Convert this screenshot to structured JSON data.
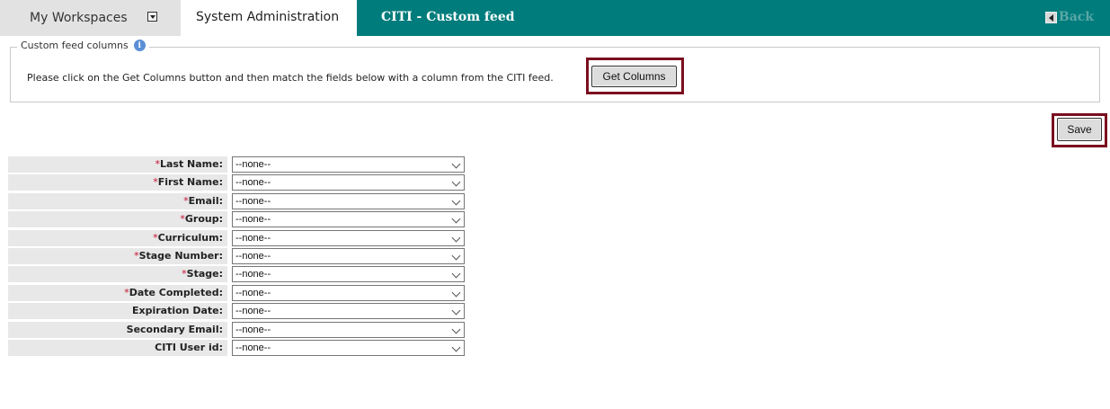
{
  "tabs": {
    "workspaces": "My Workspaces",
    "system_admin": "System Administration",
    "current": "CITI - Custom feed",
    "back": "Back"
  },
  "fieldset": {
    "legend": "Custom feed columns",
    "instruction": "Please click on the Get Columns button and then match the fields below with a column from the CITI feed.",
    "get_columns_label": "Get Columns"
  },
  "save_label": "Save",
  "fields": [
    {
      "label": "Last Name:",
      "required": "*",
      "value": "--none--"
    },
    {
      "label": "First Name:",
      "required": "*",
      "value": "--none--"
    },
    {
      "label": "Email:",
      "required": "*",
      "value": "--none--"
    },
    {
      "label": "Group:",
      "required": "*",
      "value": "--none--"
    },
    {
      "label": "Curriculum:",
      "required": "*",
      "value": "--none--"
    },
    {
      "label": "Stage Number:",
      "required": "*",
      "value": "--none--"
    },
    {
      "label": "Stage:",
      "required": "*",
      "value": "--none--"
    },
    {
      "label": "Date Completed:",
      "required": "*",
      "value": "--none--"
    },
    {
      "label": "Expiration Date:",
      "required": "",
      "value": "--none--"
    },
    {
      "label": "Secondary Email:",
      "required": "",
      "value": "--none--"
    },
    {
      "label": "CITI User id:",
      "required": "",
      "value": "--none--"
    }
  ],
  "colors": {
    "teal_header": "#017c7c",
    "highlight": "#7a0e1f",
    "required": "#c8102e"
  }
}
